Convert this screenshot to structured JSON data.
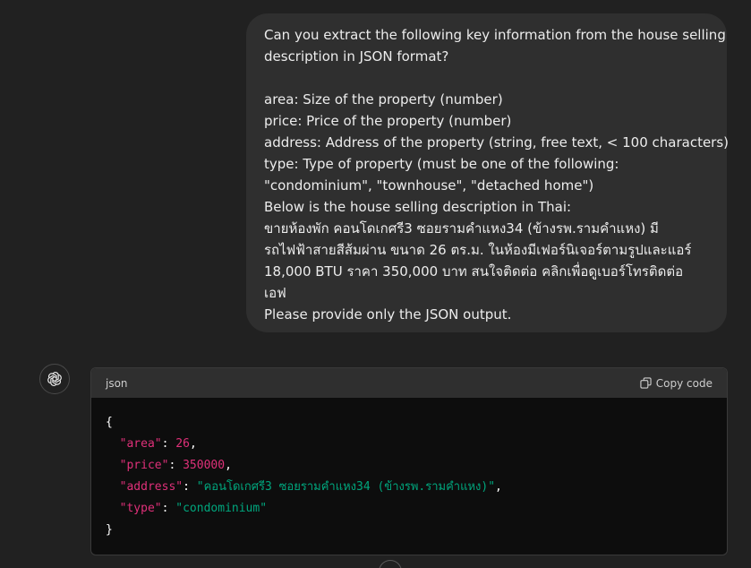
{
  "user_message": {
    "lines": [
      "Can you extract the following key information from the house selling",
      "description in JSON format?",
      "",
      "area: Size of the property (number)",
      "price: Price of the property (number)",
      "address: Address of the property (string, free text, < 100 characters)",
      "type: Type of property (must be one of the following:",
      "\"condominium\", \"townhouse\", \"detached home\")",
      "Below is the house selling description in Thai:",
      "ขายห้องพัก คอนโดเกศรี3 ซอยรามคำแหง34 (ข้างรพ.รามคำแหง) มี",
      "รถไฟฟ้าสายสีส้มผ่าน ขนาด 26 ตร.ม. ในห้องมีเฟอร์นิเจอร์ตามรูปและแอร์",
      "18,000 BTU ราคา 350,000 บาท สนใจติดต่อ คลิกเพื่อดูเบอร์โทรติดต่อ",
      "เอฟ",
      "Please provide only the JSON output."
    ]
  },
  "assistant": {
    "avatar_icon": "openai-logo-icon",
    "code_block": {
      "language": "json",
      "copy_label": "Copy code",
      "copy_icon": "copy-icon",
      "open_brace": "{",
      "close_brace": "}",
      "fields": [
        {
          "key": "\"area\"",
          "value": "26",
          "kind": "num",
          "trailing": ","
        },
        {
          "key": "\"price\"",
          "value": "350000",
          "kind": "num",
          "trailing": ","
        },
        {
          "key": "\"address\"",
          "value": "\"คอนโดเกศรี3 ซอยรามคำแหง34 (ข้างรพ.รามคำแหง)\"",
          "kind": "str",
          "trailing": ","
        },
        {
          "key": "\"type\"",
          "value": "\"condominium\"",
          "kind": "str",
          "trailing": ""
        }
      ]
    }
  },
  "colors": {
    "background": "#212121",
    "bubble": "#2f2f2f",
    "code_bg": "#0d0d0d",
    "key_color": "#df3079",
    "string_color": "#00a67d"
  }
}
